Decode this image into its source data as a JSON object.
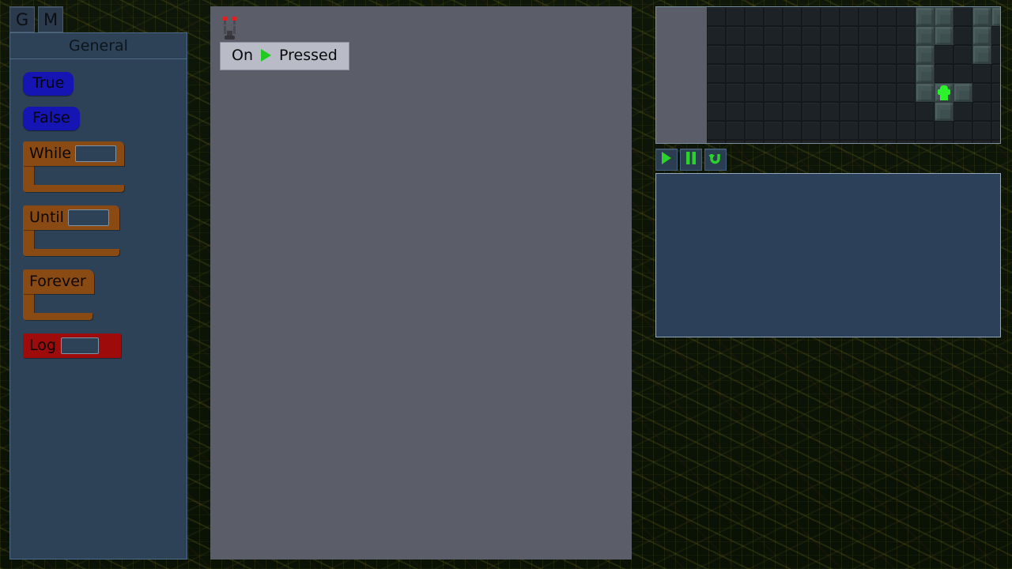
{
  "tabs": [
    {
      "label": "G",
      "name": "tab-general"
    },
    {
      "label": "M",
      "name": "tab-map"
    }
  ],
  "sidebar": {
    "title": "General",
    "blocks": {
      "true_label": "True",
      "false_label": "False",
      "while_label": "While",
      "until_label": "Until",
      "forever_label": "Forever",
      "log_label": "Log",
      "while_slot_value": "",
      "until_slot_value": "",
      "log_slot_value": ""
    }
  },
  "workspace": {
    "hat_block": {
      "prefix": "On",
      "suffix": "Pressed",
      "icon": "play-triangle-icon"
    },
    "antenna_icon": "antenna-tower-icon"
  },
  "gameview": {
    "player_icon": "player-character-sprite",
    "tile_size": 24,
    "tile_map": [
      "...........ss.sss..........sssss",
      "...........ss.s..ss......ssssssss",
      "...........s..s...ssssssssssssss",
      "...........s......ssssssssssssss",
      "...........sPs....ssssssssssssss",
      "............s.....ssssssssssssss",
      "..................ssssssssssssss",
      ".................sssss.sssssssss",
      "................ssssssssss.sssss"
    ],
    "legend": {
      ".": "dark-tile",
      "s": "stone-tile",
      "P": "player-tile"
    }
  },
  "controls": [
    {
      "name": "play-button",
      "icon": "play-icon"
    },
    {
      "name": "pause-button",
      "icon": "pause-icon"
    },
    {
      "name": "reset-button",
      "icon": "undo-arrow-icon"
    }
  ],
  "console": {
    "lines": []
  },
  "colors": {
    "background": "#0c1408",
    "panel": "#2d4257",
    "workspace": "#5b5d69",
    "bool_block": "#1515b4",
    "loop_block": "#8a4a14",
    "log_block": "#9e0b0b",
    "accent_green": "#2cf22c"
  }
}
